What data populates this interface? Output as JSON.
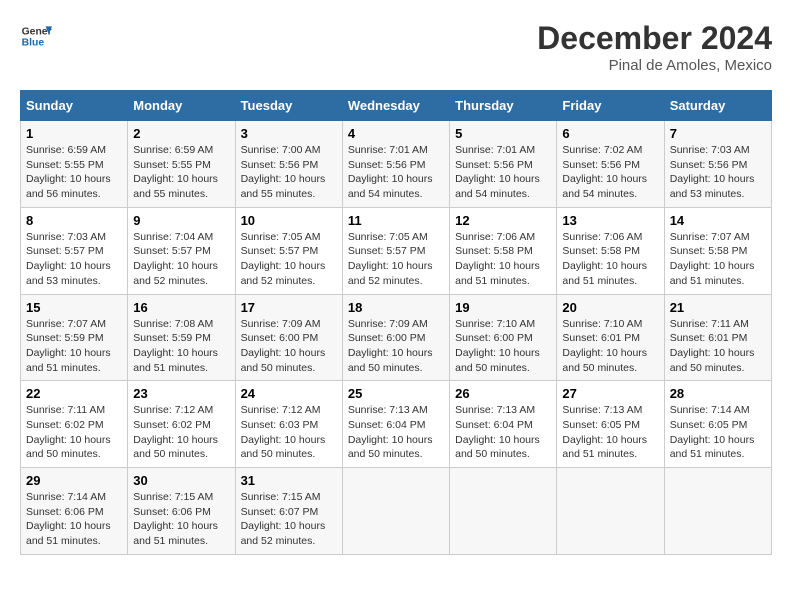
{
  "logo": {
    "line1": "General",
    "line2": "Blue"
  },
  "title": "December 2024",
  "subtitle": "Pinal de Amoles, Mexico",
  "headers": [
    "Sunday",
    "Monday",
    "Tuesday",
    "Wednesday",
    "Thursday",
    "Friday",
    "Saturday"
  ],
  "weeks": [
    [
      {
        "day": "1",
        "sunrise": "6:59 AM",
        "sunset": "5:55 PM",
        "daylight": "10 hours and 56 minutes."
      },
      {
        "day": "2",
        "sunrise": "6:59 AM",
        "sunset": "5:55 PM",
        "daylight": "10 hours and 55 minutes."
      },
      {
        "day": "3",
        "sunrise": "7:00 AM",
        "sunset": "5:56 PM",
        "daylight": "10 hours and 55 minutes."
      },
      {
        "day": "4",
        "sunrise": "7:01 AM",
        "sunset": "5:56 PM",
        "daylight": "10 hours and 54 minutes."
      },
      {
        "day": "5",
        "sunrise": "7:01 AM",
        "sunset": "5:56 PM",
        "daylight": "10 hours and 54 minutes."
      },
      {
        "day": "6",
        "sunrise": "7:02 AM",
        "sunset": "5:56 PM",
        "daylight": "10 hours and 54 minutes."
      },
      {
        "day": "7",
        "sunrise": "7:03 AM",
        "sunset": "5:56 PM",
        "daylight": "10 hours and 53 minutes."
      }
    ],
    [
      {
        "day": "8",
        "sunrise": "7:03 AM",
        "sunset": "5:57 PM",
        "daylight": "10 hours and 53 minutes."
      },
      {
        "day": "9",
        "sunrise": "7:04 AM",
        "sunset": "5:57 PM",
        "daylight": "10 hours and 52 minutes."
      },
      {
        "day": "10",
        "sunrise": "7:05 AM",
        "sunset": "5:57 PM",
        "daylight": "10 hours and 52 minutes."
      },
      {
        "day": "11",
        "sunrise": "7:05 AM",
        "sunset": "5:57 PM",
        "daylight": "10 hours and 52 minutes."
      },
      {
        "day": "12",
        "sunrise": "7:06 AM",
        "sunset": "5:58 PM",
        "daylight": "10 hours and 51 minutes."
      },
      {
        "day": "13",
        "sunrise": "7:06 AM",
        "sunset": "5:58 PM",
        "daylight": "10 hours and 51 minutes."
      },
      {
        "day": "14",
        "sunrise": "7:07 AM",
        "sunset": "5:58 PM",
        "daylight": "10 hours and 51 minutes."
      }
    ],
    [
      {
        "day": "15",
        "sunrise": "7:07 AM",
        "sunset": "5:59 PM",
        "daylight": "10 hours and 51 minutes."
      },
      {
        "day": "16",
        "sunrise": "7:08 AM",
        "sunset": "5:59 PM",
        "daylight": "10 hours and 51 minutes."
      },
      {
        "day": "17",
        "sunrise": "7:09 AM",
        "sunset": "6:00 PM",
        "daylight": "10 hours and 50 minutes."
      },
      {
        "day": "18",
        "sunrise": "7:09 AM",
        "sunset": "6:00 PM",
        "daylight": "10 hours and 50 minutes."
      },
      {
        "day": "19",
        "sunrise": "7:10 AM",
        "sunset": "6:00 PM",
        "daylight": "10 hours and 50 minutes."
      },
      {
        "day": "20",
        "sunrise": "7:10 AM",
        "sunset": "6:01 PM",
        "daylight": "10 hours and 50 minutes."
      },
      {
        "day": "21",
        "sunrise": "7:11 AM",
        "sunset": "6:01 PM",
        "daylight": "10 hours and 50 minutes."
      }
    ],
    [
      {
        "day": "22",
        "sunrise": "7:11 AM",
        "sunset": "6:02 PM",
        "daylight": "10 hours and 50 minutes."
      },
      {
        "day": "23",
        "sunrise": "7:12 AM",
        "sunset": "6:02 PM",
        "daylight": "10 hours and 50 minutes."
      },
      {
        "day": "24",
        "sunrise": "7:12 AM",
        "sunset": "6:03 PM",
        "daylight": "10 hours and 50 minutes."
      },
      {
        "day": "25",
        "sunrise": "7:13 AM",
        "sunset": "6:04 PM",
        "daylight": "10 hours and 50 minutes."
      },
      {
        "day": "26",
        "sunrise": "7:13 AM",
        "sunset": "6:04 PM",
        "daylight": "10 hours and 50 minutes."
      },
      {
        "day": "27",
        "sunrise": "7:13 AM",
        "sunset": "6:05 PM",
        "daylight": "10 hours and 51 minutes."
      },
      {
        "day": "28",
        "sunrise": "7:14 AM",
        "sunset": "6:05 PM",
        "daylight": "10 hours and 51 minutes."
      }
    ],
    [
      {
        "day": "29",
        "sunrise": "7:14 AM",
        "sunset": "6:06 PM",
        "daylight": "10 hours and 51 minutes."
      },
      {
        "day": "30",
        "sunrise": "7:15 AM",
        "sunset": "6:06 PM",
        "daylight": "10 hours and 51 minutes."
      },
      {
        "day": "31",
        "sunrise": "7:15 AM",
        "sunset": "6:07 PM",
        "daylight": "10 hours and 52 minutes."
      },
      null,
      null,
      null,
      null
    ]
  ],
  "labels": {
    "sunrise": "Sunrise:",
    "sunset": "Sunset:",
    "daylight": "Daylight:"
  }
}
